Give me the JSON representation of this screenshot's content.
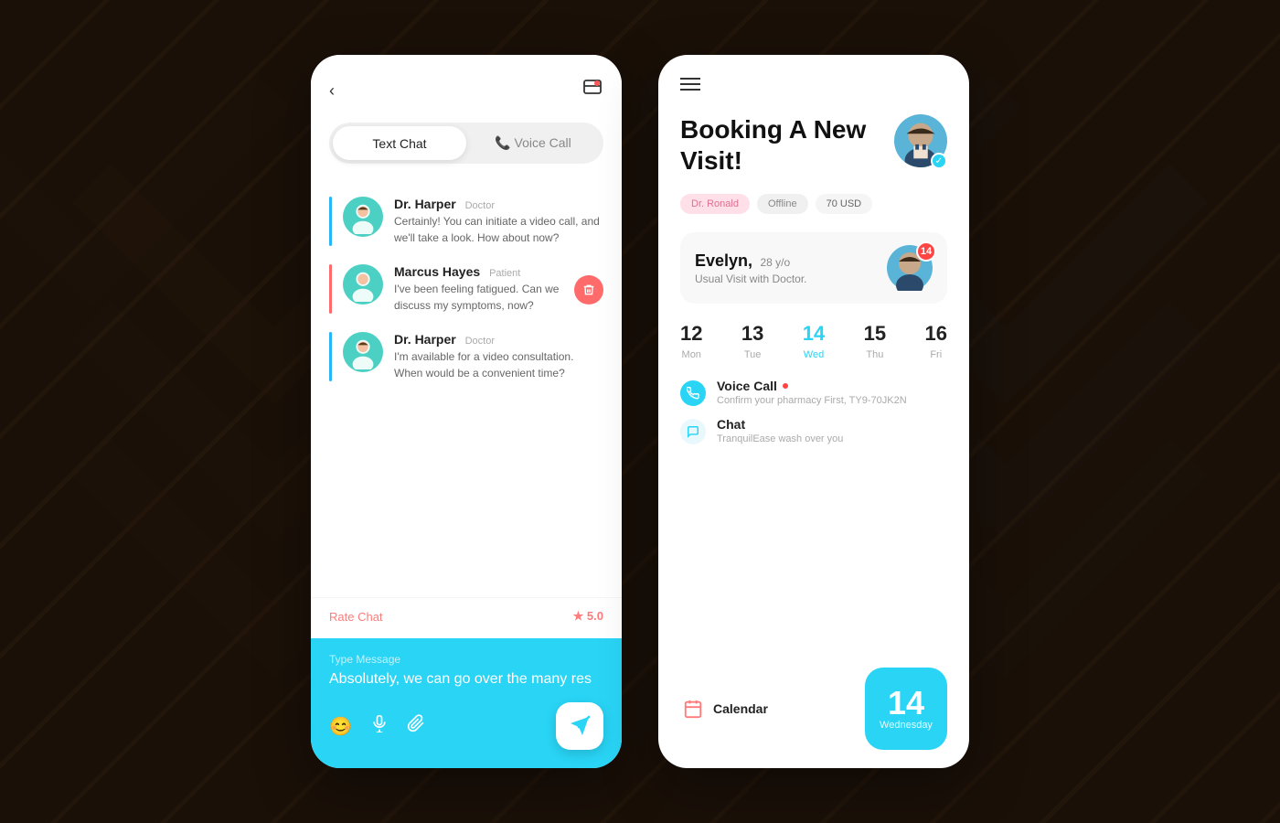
{
  "background": {
    "color": "#1a1008"
  },
  "chat_card": {
    "back_button": "‹",
    "tabs": {
      "active": "Text Chat",
      "inactive": "📞 Voice Call"
    },
    "messages": [
      {
        "name": "Dr. Harper",
        "role": "Doctor",
        "text": "Certainly! You can initiate a video call, and we'll take a look. How about now?",
        "bar_color": "blue",
        "has_delete": false
      },
      {
        "name": "Marcus Hayes",
        "role": "Patient",
        "text": "I've been feeling fatigued. Can we discuss my symptoms, now?",
        "bar_color": "red",
        "has_delete": true
      },
      {
        "name": "Dr. Harper",
        "role": "Doctor",
        "text": "I'm available for a video consultation. When would be a convenient time?",
        "bar_color": "blue",
        "has_delete": false
      }
    ],
    "rating": {
      "label": "Rate Chat",
      "stars": "★ 5.0"
    },
    "input": {
      "placeholder": "Type Message",
      "current_text": "Absolutely, we can go over the many res"
    }
  },
  "booking_card": {
    "title": "Booking A New Visit!",
    "tags": [
      {
        "label": "Dr. Ronald",
        "style": "pink"
      },
      {
        "label": "Offline",
        "style": "gray"
      },
      {
        "label": "70 USD",
        "style": "light"
      }
    ],
    "patient": {
      "name": "Evelyn,",
      "age": "28 y/o",
      "visit_type": "Usual Visit with Doctor.",
      "badge_count": "14"
    },
    "calendar": {
      "days": [
        {
          "number": "12",
          "label": "Mon",
          "active": false
        },
        {
          "number": "13",
          "label": "Tue",
          "active": false
        },
        {
          "number": "14",
          "label": "Wed",
          "active": true
        },
        {
          "number": "15",
          "label": "Thu",
          "active": false
        },
        {
          "number": "16",
          "label": "Fri",
          "active": false
        }
      ]
    },
    "schedule": [
      {
        "title": "Voice Call",
        "subtitle": "Confirm your pharmacy First, TY9-70JK2N",
        "dot_style": "blue",
        "has_indicator": true
      },
      {
        "title": "Chat",
        "subtitle": "TranquilEase wash over you",
        "dot_style": "light",
        "has_indicator": false
      }
    ],
    "calendar_bottom": {
      "label": "Calendar",
      "big_number": "14",
      "big_day": "Wednesday"
    }
  }
}
